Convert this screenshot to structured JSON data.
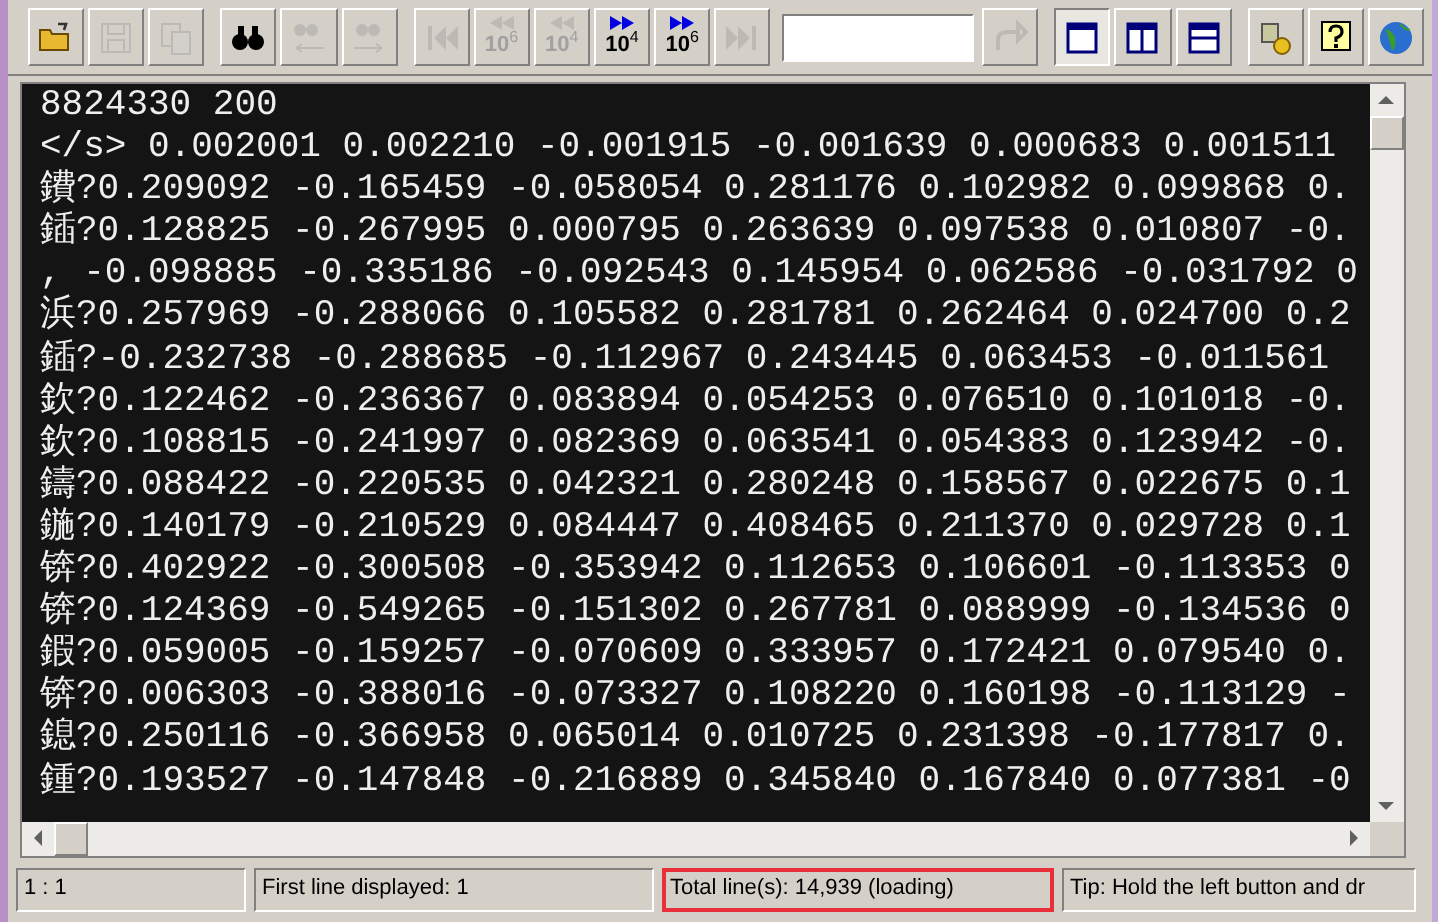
{
  "toolbar": [
    {
      "kind": "open",
      "disabled": false,
      "pressed": false
    },
    {
      "kind": "save",
      "disabled": true,
      "pressed": false
    },
    {
      "kind": "copy",
      "disabled": true,
      "pressed": false
    },
    {
      "kind": "sep"
    },
    {
      "kind": "find",
      "disabled": false,
      "pressed": false
    },
    {
      "kind": "find-prev",
      "disabled": true,
      "pressed": false
    },
    {
      "kind": "find-next",
      "disabled": true,
      "pressed": false
    },
    {
      "kind": "sep"
    },
    {
      "kind": "first",
      "disabled": true,
      "pressed": false
    },
    {
      "kind": "back-power",
      "base": "10",
      "exponent": "6",
      "disabled": true,
      "pressed": false
    },
    {
      "kind": "back-power",
      "base": "10",
      "exponent": "4",
      "disabled": true,
      "pressed": false
    },
    {
      "kind": "forward-power",
      "base": "10",
      "exponent": "4",
      "disabled": false,
      "pressed": false
    },
    {
      "kind": "forward-power",
      "base": "10",
      "exponent": "6",
      "disabled": false,
      "pressed": false
    },
    {
      "kind": "last",
      "disabled": true,
      "pressed": false
    },
    {
      "kind": "field"
    },
    {
      "kind": "go",
      "disabled": true,
      "pressed": false
    },
    {
      "kind": "sep"
    },
    {
      "kind": "view-single",
      "disabled": false,
      "pressed": true
    },
    {
      "kind": "view-columns",
      "disabled": false,
      "pressed": false
    },
    {
      "kind": "view-rows",
      "disabled": false,
      "pressed": false
    },
    {
      "kind": "sep"
    },
    {
      "kind": "settings",
      "disabled": false,
      "pressed": false
    },
    {
      "kind": "help",
      "disabled": false,
      "pressed": false
    },
    {
      "kind": "web",
      "disabled": false,
      "pressed": false
    }
  ],
  "lines": [
    "8824330 200",
    "</s> 0.002001 0.002210 -0.001915 -0.001639 0.000683 0.001511",
    "鐨?0.209092 -0.165459 -0.058054 0.281176 0.102982 0.099868 0.",
    "鍤?0.128825 -0.267995 0.000795 0.263639 0.097538 0.010807 -0.",
    ", -0.098885 -0.335186 -0.092543 0.145954 0.062586 -0.031792 0",
    "浜?0.257969 -0.288066 0.105582 0.281781 0.262464 0.024700 0.2",
    "鍤?-0.232738 -0.288685 -0.112967 0.243445 0.063453 -0.011561",
    "欽?0.122462 -0.236367 0.083894 0.054253 0.076510 0.101018 -0.",
    "欽?0.108815 -0.241997 0.082369 0.063541 0.054383 0.123942 -0.",
    "鑄?0.088422 -0.220535 0.042321 0.280248 0.158567 0.022675 0.1",
    "鍦?0.140179 -0.210529 0.084447 0.408465 0.211370 0.029728 0.1",
    "锛?0.402922 -0.300508 -0.353942 0.112653 0.106601 -0.113353 0",
    "锛?0.124369 -0.549265 -0.151302 0.267781 0.088999 -0.134536 0",
    "鍜?0.059005 -0.159257 -0.070609 0.333957 0.172421 0.079540 0.",
    "锛?0.006303 -0.388016 -0.073327 0.108220 0.160198 -0.113129 -",
    "鎴?0.250116 -0.366958 0.065014 0.010725 0.231398 -0.177817 0.",
    "鍾?0.193527 -0.147848 -0.216889 0.345840 0.167840 0.077381 -0"
  ],
  "status_bar": [
    {
      "text": "1 : 1",
      "highlighted": false
    },
    {
      "text": "First line displayed: 1",
      "highlighted": false
    },
    {
      "text": "Total line(s): 14,939 (loading)",
      "highlighted": true
    },
    {
      "text": "Tip: Hold the left button and dr",
      "highlighted": false
    }
  ]
}
